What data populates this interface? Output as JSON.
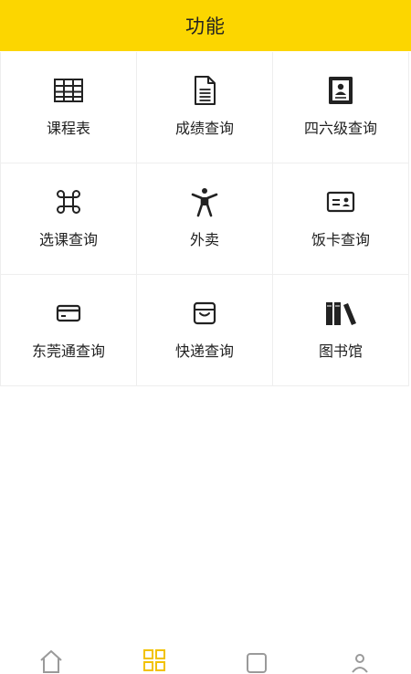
{
  "header": {
    "title": "功能"
  },
  "colors": {
    "accent": "#fcd600",
    "icon": "#222222",
    "nav_icon": "#9a9a9a",
    "nav_active": "#f2c200"
  },
  "grid": {
    "items": [
      {
        "label": "课程表",
        "icon": "table-icon"
      },
      {
        "label": "成绩查询",
        "icon": "document-icon"
      },
      {
        "label": "四六级查询",
        "icon": "id-card-icon"
      },
      {
        "label": "选课查询",
        "icon": "command-icon"
      },
      {
        "label": "外卖",
        "icon": "person-icon"
      },
      {
        "label": "饭卡查询",
        "icon": "card-icon"
      },
      {
        "label": "东莞通查询",
        "icon": "credit-card-icon"
      },
      {
        "label": "快递查询",
        "icon": "package-icon"
      },
      {
        "label": "图书馆",
        "icon": "books-icon"
      }
    ]
  },
  "bottom_nav": {
    "items": [
      {
        "icon": "home-icon",
        "active": false
      },
      {
        "icon": "grid-icon",
        "active": true
      },
      {
        "icon": "square-icon",
        "active": false
      },
      {
        "icon": "profile-icon",
        "active": false
      }
    ]
  }
}
